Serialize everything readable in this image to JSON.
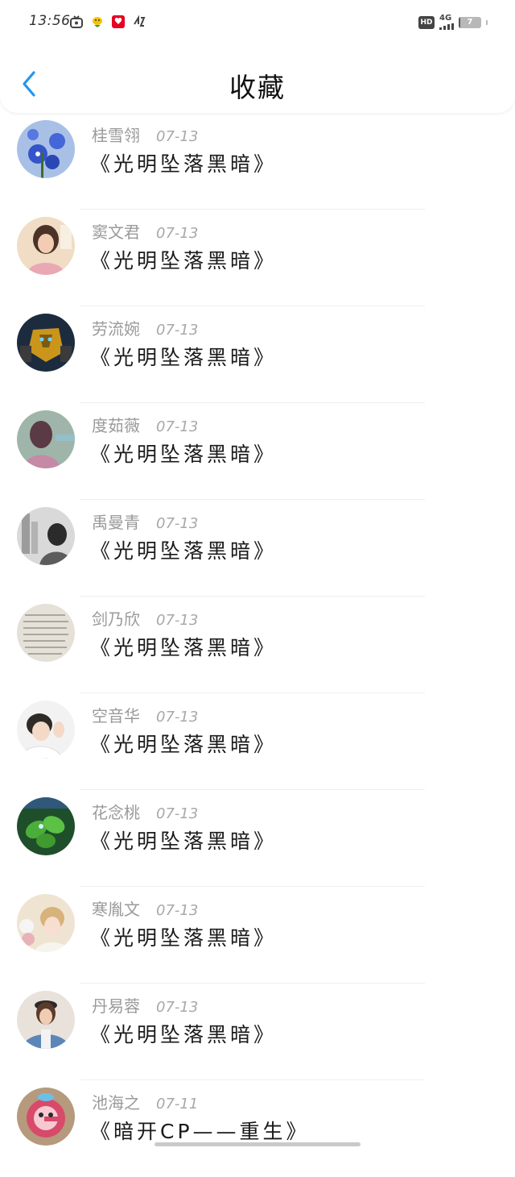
{
  "status_bar": {
    "time": "13:56",
    "network": "4G",
    "battery_text": "7",
    "battery_level": 0.07
  },
  "header": {
    "title": "收藏"
  },
  "favorites": [
    {
      "name": "桂雪翎",
      "date": "07-13",
      "title": "《光明坠落黑暗》"
    },
    {
      "name": "窦文君",
      "date": "07-13",
      "title": "《光明坠落黑暗》"
    },
    {
      "name": "劳流婉",
      "date": "07-13",
      "title": "《光明坠落黑暗》"
    },
    {
      "name": "度茹薇",
      "date": "07-13",
      "title": "《光明坠落黑暗》"
    },
    {
      "name": "禹曼青",
      "date": "07-13",
      "title": "《光明坠落黑暗》"
    },
    {
      "name": "剑乃欣",
      "date": "07-13",
      "title": "《光明坠落黑暗》"
    },
    {
      "name": "空音华",
      "date": "07-13",
      "title": "《光明坠落黑暗》"
    },
    {
      "name": "花念桃",
      "date": "07-13",
      "title": "《光明坠落黑暗》"
    },
    {
      "name": "寒胤文",
      "date": "07-13",
      "title": "《光明坠落黑暗》"
    },
    {
      "name": "丹易蓉",
      "date": "07-13",
      "title": "《光明坠落黑暗》"
    },
    {
      "name": "池海之",
      "date": "07-11",
      "title": "《暗开CP——重生》"
    }
  ],
  "colors": {
    "accent": "#2196F3",
    "title_text": "#1a1a1a",
    "meta_text": "#9a9a9a"
  }
}
